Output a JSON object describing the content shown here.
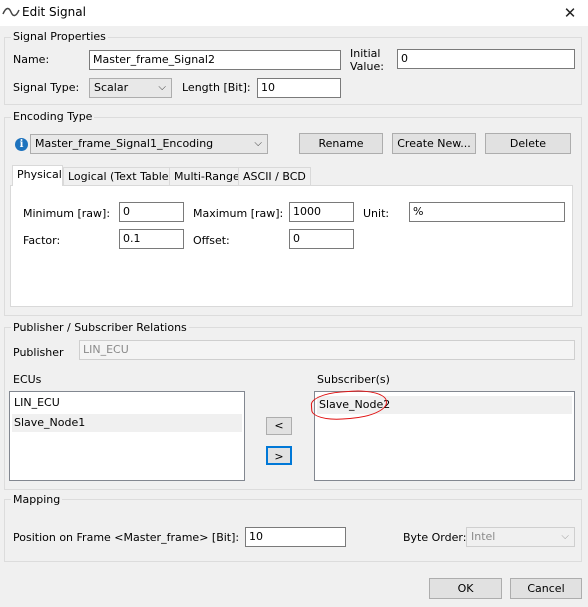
{
  "window": {
    "title": "Edit Signal",
    "close_glyph": "✕"
  },
  "signal_properties": {
    "group_label": "Signal Properties",
    "name_label": "Name:",
    "name_value": "Master_frame_Signal2",
    "initial_value_label_line1": "Initial",
    "initial_value_label_line2": "Value:",
    "initial_value": "0",
    "signal_type_label": "Signal Type:",
    "signal_type_value": "Scalar",
    "length_label": "Length [Bit]:",
    "length_value": "10"
  },
  "encoding": {
    "group_label": "Encoding Type",
    "info_glyph": "i",
    "selected": "Master_frame_Signal1_Encoding",
    "rename_button": "Rename",
    "create_new_button": "Create New...",
    "delete_button": "Delete",
    "tabs": [
      {
        "label": "Physical",
        "active": true
      },
      {
        "label": "Logical (Text Table)",
        "active": false
      },
      {
        "label": "Multi-Range",
        "active": false
      },
      {
        "label": "ASCII / BCD",
        "active": false
      }
    ],
    "physical": {
      "minimum_label": "Minimum [raw]:",
      "minimum_value": "0",
      "maximum_label": "Maximum [raw]:",
      "maximum_value": "1000",
      "unit_label": "Unit:",
      "unit_value": "%",
      "factor_label": "Factor:",
      "factor_value": "0.1",
      "offset_label": "Offset:",
      "offset_value": "0"
    }
  },
  "pub_sub": {
    "group_label": "Publisher / Subscriber Relations",
    "publisher_label": "Publisher",
    "publisher_value": "LIN_ECU",
    "ecus_label": "ECUs",
    "ecus": [
      "LIN_ECU",
      "Slave_Node1"
    ],
    "subscribers_label": "Subscriber(s)",
    "subscribers": [
      "Slave_Node2"
    ],
    "move_left_button": "<",
    "move_right_button": ">"
  },
  "mapping": {
    "group_label": "Mapping",
    "position_label": "Position on Frame <Master_frame> [Bit]:",
    "position_value": "10",
    "byte_order_label": "Byte Order:",
    "byte_order_value": "Intel"
  },
  "footer": {
    "ok_button": "OK",
    "cancel_button": "Cancel"
  },
  "colors": {
    "accent": "#0078d7",
    "annotation": "#e01010",
    "info": "#1e73be"
  }
}
